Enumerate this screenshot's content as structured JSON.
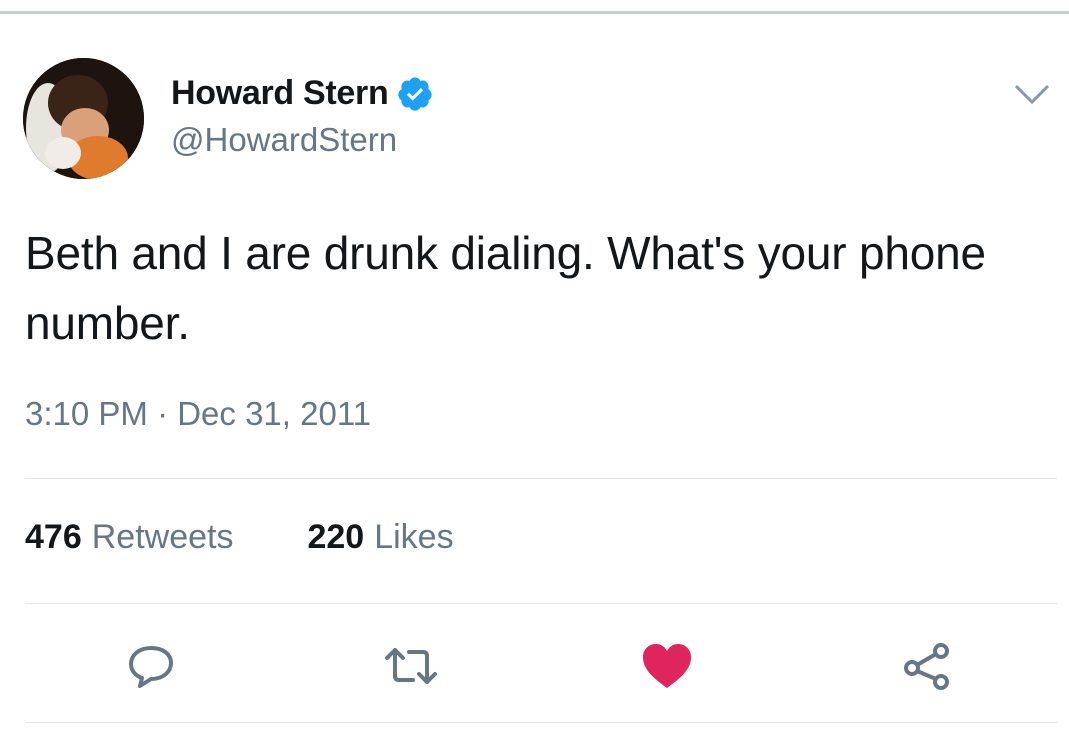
{
  "tweet": {
    "author": {
      "display_name": "Howard Stern",
      "handle": "@HowardStern",
      "verified": true,
      "avatar": "avatar-photo"
    },
    "text": "Beth and I are drunk dialing. What's your phone number.",
    "timestamp": "3:10 PM · Dec 31, 2011",
    "stats": {
      "retweets_count": "476",
      "retweets_label": "Retweets",
      "likes_count": "220",
      "likes_label": "Likes"
    },
    "actions": [
      {
        "name": "reply",
        "icon": "reply-icon"
      },
      {
        "name": "retweet",
        "icon": "retweet-icon"
      },
      {
        "name": "like",
        "icon": "heart-icon",
        "active": true
      },
      {
        "name": "share",
        "icon": "share-icon"
      }
    ]
  },
  "colors": {
    "verified_blue": "#1da1f2",
    "like_red": "#e0245e",
    "secondary_text": "#657786",
    "divider": "#e1e8ed"
  }
}
